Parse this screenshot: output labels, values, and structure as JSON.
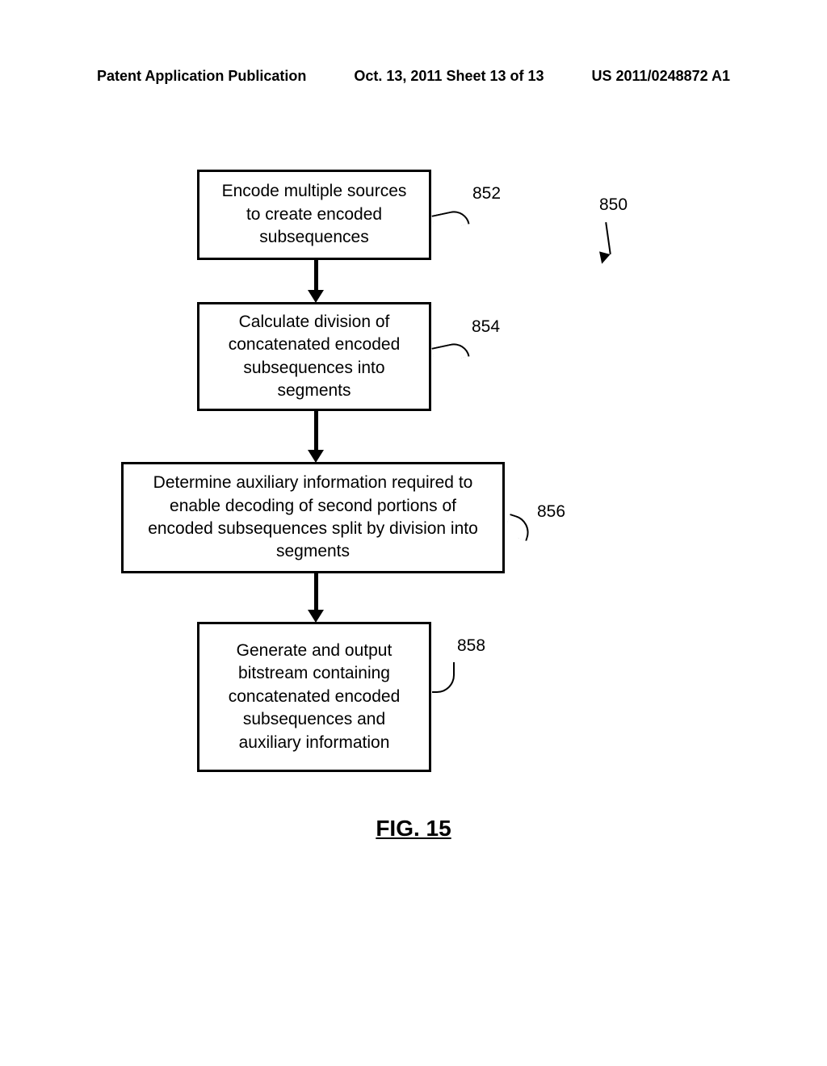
{
  "header": {
    "left": "Patent Application Publication",
    "center": "Oct. 13, 2011  Sheet 13 of 13",
    "right": "US 2011/0248872 A1"
  },
  "flowchart": {
    "ref": "850",
    "steps": [
      {
        "id": "852",
        "text": "Encode multiple sources to create encoded subsequences"
      },
      {
        "id": "854",
        "text": "Calculate division of concatenated encoded subsequences into segments"
      },
      {
        "id": "856",
        "text": "Determine auxiliary information required to enable decoding of second portions of encoded subsequences split by division into segments"
      },
      {
        "id": "858",
        "text": "Generate and output bitstream containing concatenated encoded subsequences and auxiliary information"
      }
    ]
  },
  "figure_label": "FIG. 15"
}
